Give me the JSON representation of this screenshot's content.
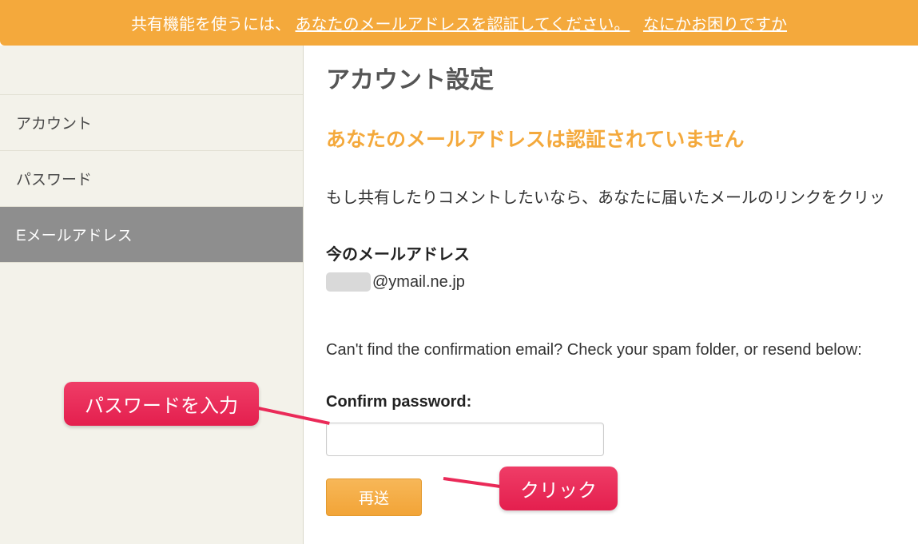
{
  "banner": {
    "prefix": "共有機能を使うには、",
    "link1": "あなたのメールアドレスを認証してください。",
    "link2": "なにかお困りですか"
  },
  "sidebar": {
    "items": [
      {
        "label": "アカウント"
      },
      {
        "label": "パスワード"
      },
      {
        "label": "Eメールアドレス"
      }
    ]
  },
  "main": {
    "page_title": "アカウント設定",
    "warning": "あなたのメールアドレスは認証されていません",
    "paragraph": "もし共有したりコメントしたいなら、あなたに届いたメールのリンクをクリッ",
    "current_email_label": "今のメールアドレス",
    "current_email_domain": "@ymail.ne.jp",
    "spam_hint": "Can't find the confirmation email? Check your spam folder, or resend below:",
    "confirm_password_label": "Confirm password:",
    "password_value": "",
    "resend_label": "再送"
  },
  "callouts": {
    "password": "パスワードを入力",
    "click": "クリック"
  }
}
